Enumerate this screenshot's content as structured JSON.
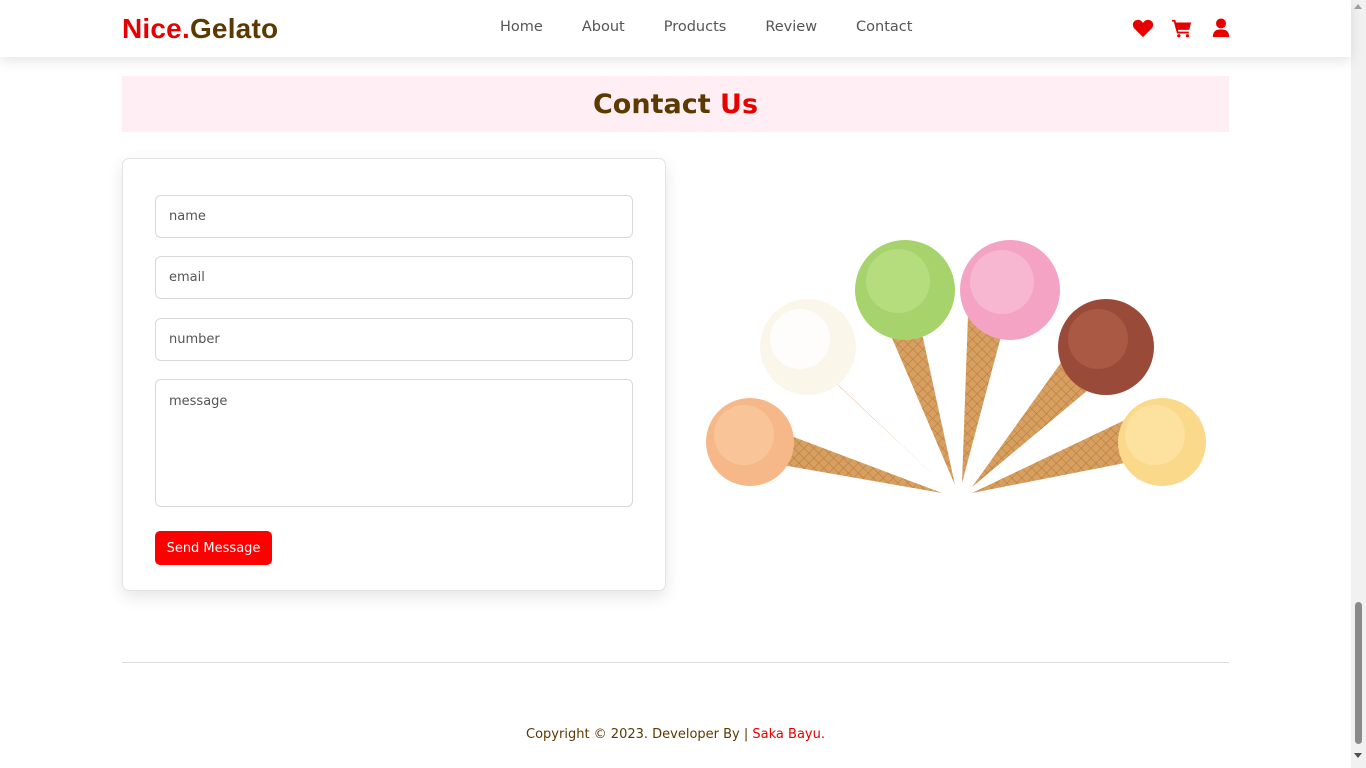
{
  "header": {
    "logo_part1": "Nice.",
    "logo_part2": "Gelato",
    "nav": [
      "Home",
      "About",
      "Products",
      "Review",
      "Contact"
    ],
    "icons": [
      "heart-icon",
      "cart-icon",
      "user-icon"
    ]
  },
  "section": {
    "title_part1": "Contact",
    "title_part2": "Us"
  },
  "form": {
    "name_placeholder": "name",
    "email_placeholder": "email",
    "number_placeholder": "number",
    "message_placeholder": "message",
    "send_label": "Send Message"
  },
  "footer": {
    "copyright": "Copyright © 2023. Developer By | ",
    "developer": "Saka Bayu."
  },
  "colors": {
    "accent_red": "#e60000",
    "brown": "#5a3a00",
    "title_bg": "#ffeef4"
  }
}
